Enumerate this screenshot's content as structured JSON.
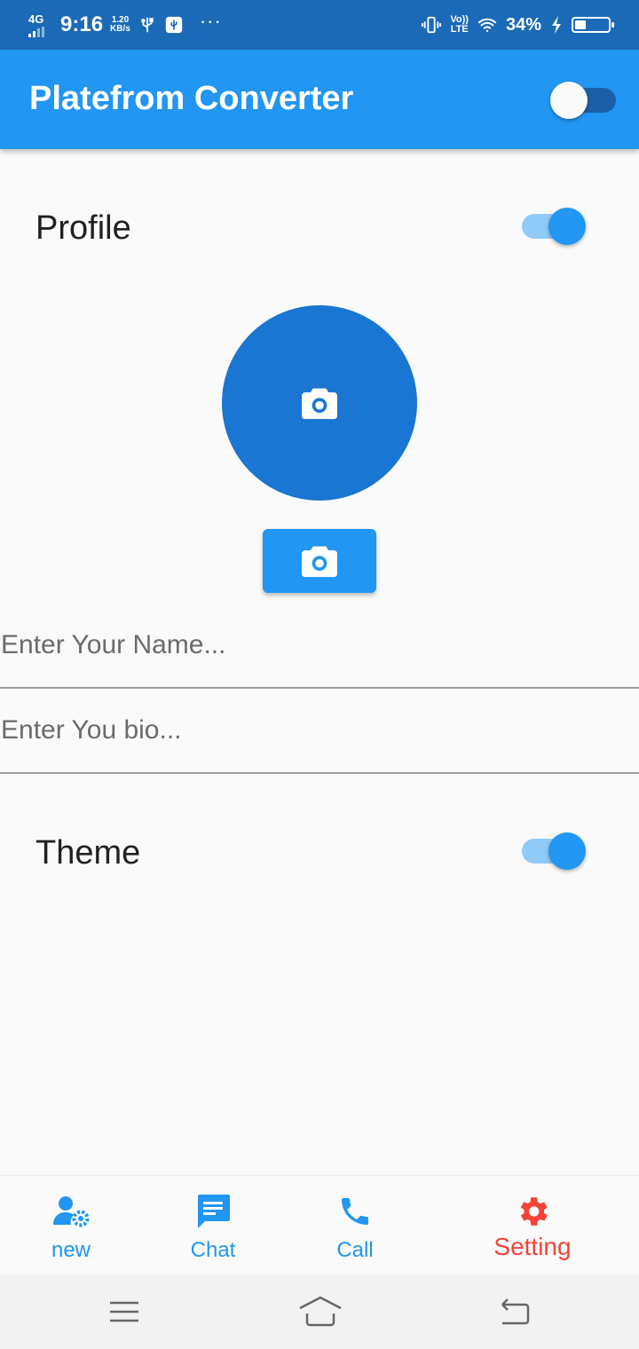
{
  "status_bar": {
    "network": "4G",
    "time": "9:16",
    "speed_value": "1.20",
    "speed_unit": "KB/s",
    "volte_label": "Vo))",
    "lte_label": "LTE",
    "battery_percent": "34%",
    "battery_level": 0.34,
    "more": "···"
  },
  "appbar": {
    "title": "Platefrom Converter",
    "dark_mode_switch_on": false
  },
  "profile": {
    "label": "Profile",
    "switch_on": true
  },
  "name_field": {
    "placeholder": "Enter Your Name...",
    "value": ""
  },
  "bio_field": {
    "placeholder": "Enter You bio...",
    "value": ""
  },
  "theme": {
    "label": "Theme",
    "switch_on": true
  },
  "bottom_nav": {
    "items": [
      {
        "label": "new",
        "icon": "user-gear-icon",
        "active": false
      },
      {
        "label": "Chat",
        "icon": "chat-icon",
        "active": false
      },
      {
        "label": "Call",
        "icon": "phone-icon",
        "active": false
      },
      {
        "label": "Setting",
        "icon": "gear-icon",
        "active": true
      }
    ]
  },
  "colors": {
    "primary": "#2196f3",
    "primary_dark": "#1976d2",
    "status_bar": "#1b6ab8",
    "active_nav": "#f44336",
    "switch_track_on": "#90caf9"
  }
}
